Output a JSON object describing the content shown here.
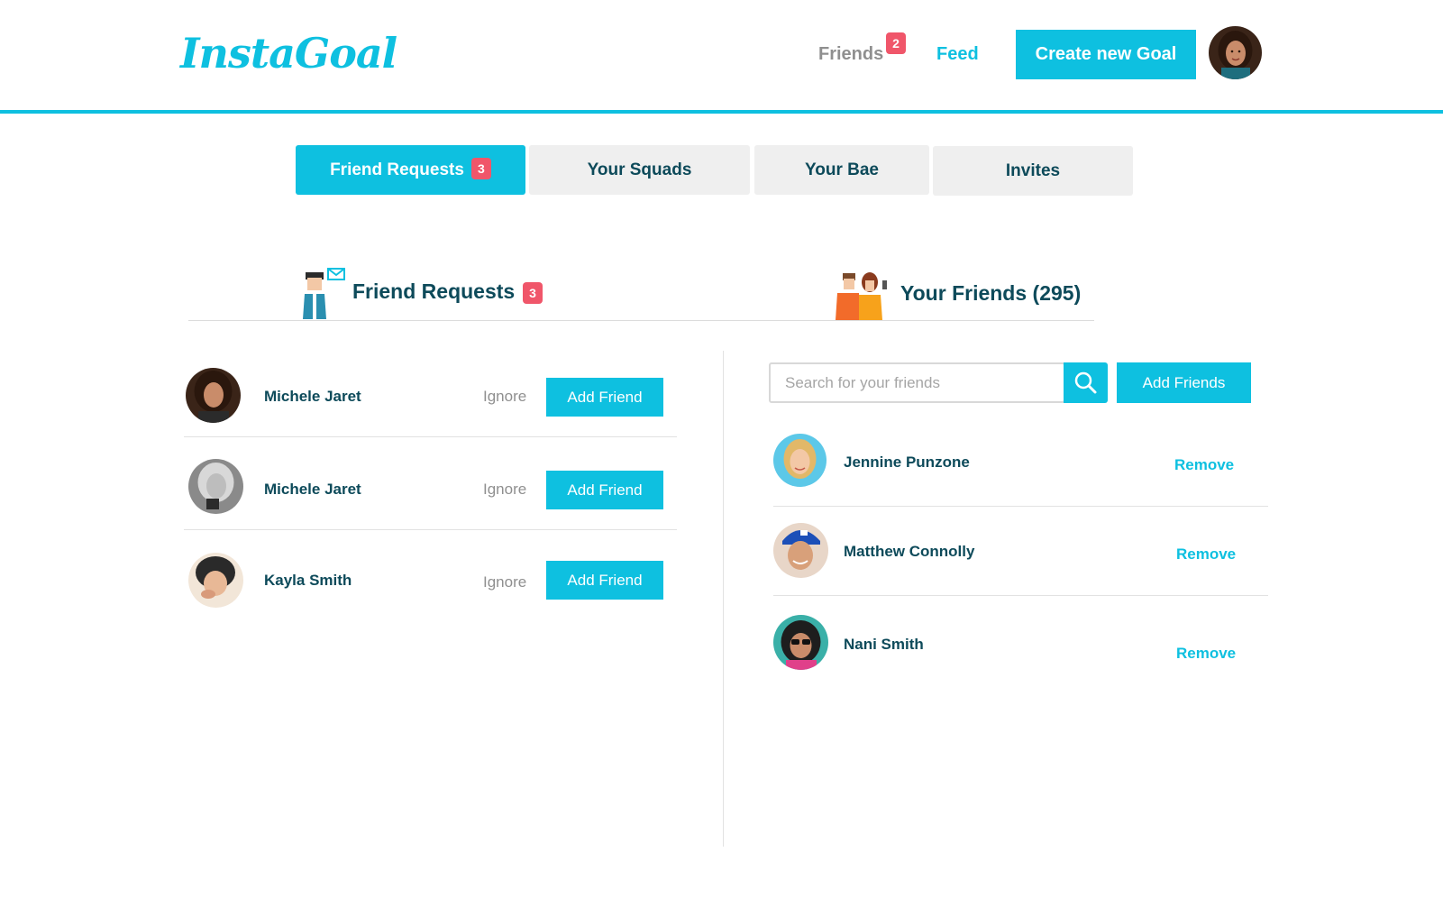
{
  "header": {
    "logo": "InstaGoal",
    "nav_friends": "Friends",
    "nav_friends_badge": "2",
    "nav_feed": "Feed",
    "create_button": "Create new Goal"
  },
  "tabs": [
    {
      "label": "Friend Requests",
      "badge": "3"
    },
    {
      "label": "Your Squads"
    },
    {
      "label": "Your Bae"
    },
    {
      "label": "Invites"
    }
  ],
  "requests_section": {
    "title": "Friend Requests",
    "badge": "3",
    "items": [
      {
        "name": "Michele Jaret",
        "ignore": "Ignore",
        "add": "Add Friend"
      },
      {
        "name": "Michele Jaret",
        "ignore": "Ignore",
        "add": "Add Friend"
      },
      {
        "name": "Kayla Smith",
        "ignore": "Ignore",
        "add": "Add Friend"
      }
    ]
  },
  "friends_section": {
    "title": "Your Friends (295)",
    "search_placeholder": "Search for your friends",
    "add_friends": "Add Friends",
    "items": [
      {
        "name": "Jennine Punzone",
        "remove": "Remove"
      },
      {
        "name": "Matthew Connolly",
        "remove": "Remove"
      },
      {
        "name": "Nani Smith",
        "remove": "Remove"
      }
    ]
  },
  "colors": {
    "accent": "#0ec0e0",
    "badge": "#f0566a",
    "text_dark": "#0d4a5a",
    "text_muted": "#8f8f8f"
  }
}
